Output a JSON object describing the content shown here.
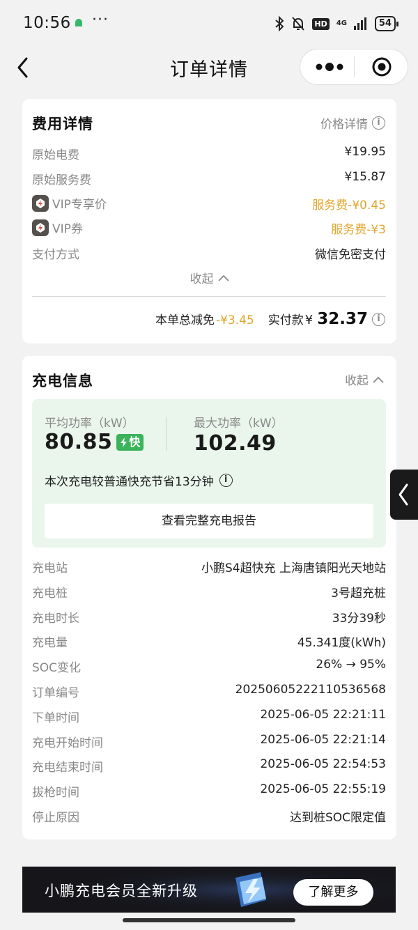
{
  "status_bar": {
    "time": "10:56",
    "dots": "···",
    "hd": "HD",
    "network": "4G",
    "battery": "54"
  },
  "nav": {
    "title": "订单详情"
  },
  "fee": {
    "title": "费用详情",
    "price_detail_label": "价格详情",
    "rows": [
      {
        "label": "原始电费",
        "value": "¥19.95"
      },
      {
        "label": "原始服务费",
        "value": "¥15.87"
      },
      {
        "label": "VIP专享价",
        "value": "服务费-¥0.45",
        "vip": true
      },
      {
        "label": "VIP券",
        "value": "服务费-¥3",
        "vip": true
      },
      {
        "label": "支付方式",
        "value": "微信免密支付"
      }
    ],
    "collapse_label": "收起",
    "total_discount_label": "本单总减免",
    "total_discount_value": "-¥3.45",
    "paid_label": "实付款",
    "paid_currency": "¥",
    "paid_value": "32.37"
  },
  "charging": {
    "title": "充电信息",
    "collapse_label": "收起",
    "avg_power_label": "平均功率（kW）",
    "avg_power_value": "80.85",
    "fast_badge": "快",
    "max_power_label": "最大功率（kW）",
    "max_power_value": "102.49",
    "saving_note": "本次充电较普通快充节省13分钟",
    "report_button": "查看完整充电报告",
    "rows": [
      {
        "label": "充电站",
        "value": "小鹏S4超快充 上海唐镇阳光天地站"
      },
      {
        "label": "充电桩",
        "value": "3号超充桩"
      },
      {
        "label": "充电时长",
        "value": "33分39秒"
      },
      {
        "label": "充电量",
        "value": "45.341度(kWh)"
      },
      {
        "label": "SOC变化",
        "value": "26% → 95%"
      },
      {
        "label": "订单编号",
        "value": "20250605222110536568"
      },
      {
        "label": "下单时间",
        "value": "2025-06-05 22:21:11"
      },
      {
        "label": "充电开始时间",
        "value": "2025-06-05 22:21:14"
      },
      {
        "label": "充电结束时间",
        "value": "2025-06-05 22:54:53"
      },
      {
        "label": "拔枪时间",
        "value": "2025-06-05 22:55:19"
      },
      {
        "label": "停止原因",
        "value": "达到桩SOC限定值"
      }
    ]
  },
  "banner": {
    "text": "小鹏充电会员全新升级",
    "button": "了解更多"
  },
  "colors": {
    "gold": "#e1a52e",
    "fast_green": "#3bb35a",
    "stats_bg": "#eaf6ec"
  }
}
